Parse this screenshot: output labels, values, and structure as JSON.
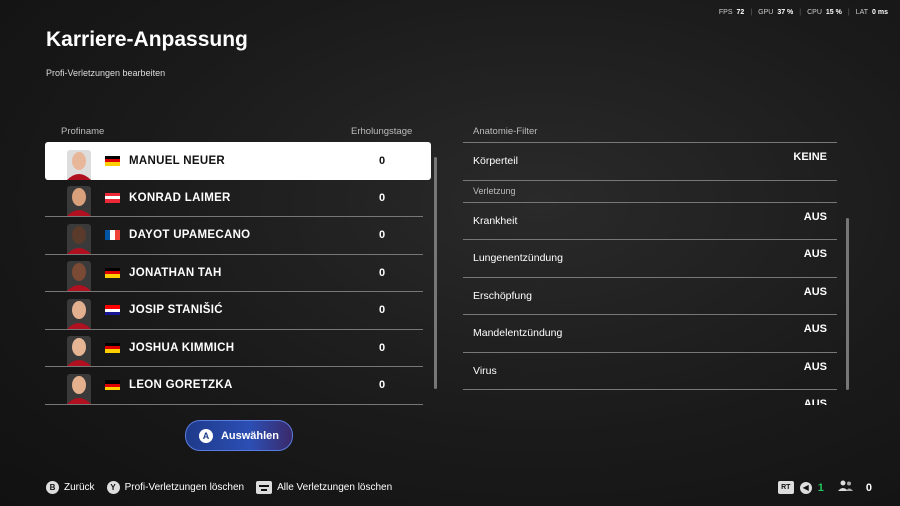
{
  "perf": {
    "fps_label": "FPS",
    "fps_value": "72",
    "gpu_label": "GPU",
    "gpu_value": "37 %",
    "cpu_label": "CPU",
    "cpu_value": "15 %",
    "lat_label": "LAT",
    "lat_value": "0 ms"
  },
  "page": {
    "title": "Karriere-Anpassung",
    "subtitle": "Profi-Verletzungen bearbeiten"
  },
  "list": {
    "col_name": "Profiname",
    "col_days": "Erholungstage",
    "players": [
      {
        "name": "MANUEL NEUER",
        "days": "0",
        "flag": "de"
      },
      {
        "name": "KONRAD LAIMER",
        "days": "0",
        "flag": "at"
      },
      {
        "name": "DAYOT UPAMECANO",
        "days": "0",
        "flag": "fr"
      },
      {
        "name": "JONATHAN TAH",
        "days": "0",
        "flag": "de"
      },
      {
        "name": "JOSIP STANIŠIĆ",
        "days": "0",
        "flag": "hr"
      },
      {
        "name": "JOSHUA KIMMICH",
        "days": "0",
        "flag": "de"
      },
      {
        "name": "LEON GORETZKA",
        "days": "0",
        "flag": "de"
      }
    ]
  },
  "filter": {
    "header": "Anatomie-Filter",
    "body_part_label": "Körperteil",
    "body_part_value": "KEINE",
    "section": "Verletzung",
    "items": [
      {
        "label": "Krankheit",
        "value": "AUS"
      },
      {
        "label": "Lungenentzündung",
        "value": "AUS"
      },
      {
        "label": "Erschöpfung",
        "value": "AUS"
      },
      {
        "label": "Mandelentzündung",
        "value": "AUS"
      },
      {
        "label": "Virus",
        "value": "AUS"
      },
      {
        "label": "",
        "value": "AUS"
      }
    ]
  },
  "select_button": {
    "glyph": "A",
    "label": "Auswählen"
  },
  "footer": {
    "back_glyph": "B",
    "back_label": "Zurück",
    "clear_glyph": "Y",
    "clear_label": "Profi-Verletzungen löschen",
    "clear_all_label": "Alle Verletzungen löschen",
    "rt_label": "RT",
    "count_left": "1",
    "count_right": "0"
  },
  "colors": {
    "accent": "#2c4fb5",
    "online": "#22c55e"
  }
}
